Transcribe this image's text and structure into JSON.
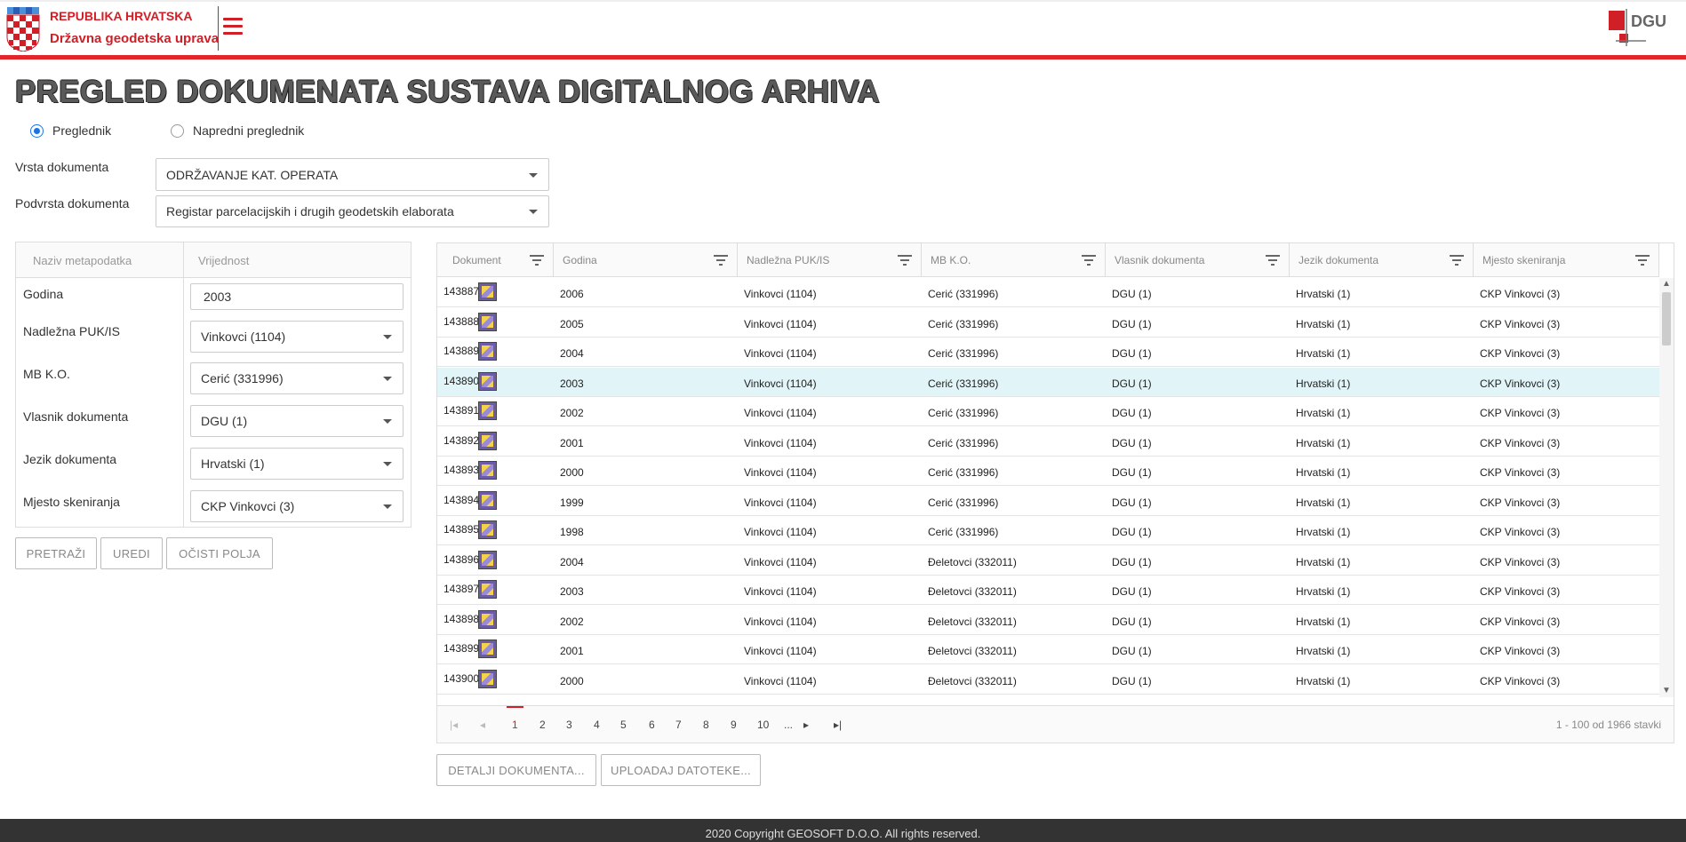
{
  "header": {
    "brand_line1": "REPUBLIKA HRVATSKA",
    "brand_line2": "Državna geodetska uprava",
    "logo_text": "DGU",
    "accent_color": "#e2262a"
  },
  "page_title": "PREGLED DOKUMENATA SUSTAVA DIGITALNOG ARHIVA",
  "mode": {
    "option1": "Preglednik",
    "option2": "Napredni preglednik",
    "selected": "Preglednik"
  },
  "filters": {
    "vrsta_label": "Vrsta dokumenta",
    "vrsta_value": "ODRŽAVANJE KAT. OPERATA",
    "podvrsta_label": "Podvrsta dokumenta",
    "podvrsta_value": "Registar parcelacijskih i drugih geodetskih elaborata"
  },
  "meta": {
    "col1": "Naziv metapodatka",
    "col2": "Vrijednost",
    "rows": [
      {
        "label": "Godina",
        "value": "2003"
      },
      {
        "label": "Nadležna PUK/IS",
        "value": "Vinkovci (1104)"
      },
      {
        "label": "MB K.O.",
        "value": "Cerić (331996)"
      },
      {
        "label": "Vlasnik dokumenta",
        "value": "DGU (1)"
      },
      {
        "label": "Jezik dokumenta",
        "value": "Hrvatski (1)"
      },
      {
        "label": "Mjesto skeniranja",
        "value": "CKP Vinkovci (3)"
      }
    ]
  },
  "buttons": {
    "search": "PRETRAŽI",
    "edit": "UREDI",
    "clear": "OČISTI POLJA",
    "details": "DETALJI DOKUMENTA...",
    "upload": "UPLOADAJ DATOTEKE..."
  },
  "grid": {
    "columns": [
      "Dokument",
      "Godina",
      "Nadležna PUK/IS",
      "MB K.O.",
      "Vlasnik dokumenta",
      "Jezik dokumenta",
      "Mjesto skeniranja"
    ],
    "rows": [
      [
        "143887",
        "2006",
        "Vinkovci (1104)",
        "Cerić (331996)",
        "DGU (1)",
        "Hrvatski (1)",
        "CKP Vinkovci (3)"
      ],
      [
        "143888",
        "2005",
        "Vinkovci (1104)",
        "Cerić (331996)",
        "DGU (1)",
        "Hrvatski (1)",
        "CKP Vinkovci (3)"
      ],
      [
        "143889",
        "2004",
        "Vinkovci (1104)",
        "Cerić (331996)",
        "DGU (1)",
        "Hrvatski (1)",
        "CKP Vinkovci (3)"
      ],
      [
        "143890",
        "2003",
        "Vinkovci (1104)",
        "Cerić (331996)",
        "DGU (1)",
        "Hrvatski (1)",
        "CKP Vinkovci (3)"
      ],
      [
        "143891",
        "2002",
        "Vinkovci (1104)",
        "Cerić (331996)",
        "DGU (1)",
        "Hrvatski (1)",
        "CKP Vinkovci (3)"
      ],
      [
        "143892",
        "2001",
        "Vinkovci (1104)",
        "Cerić (331996)",
        "DGU (1)",
        "Hrvatski (1)",
        "CKP Vinkovci (3)"
      ],
      [
        "143893",
        "2000",
        "Vinkovci (1104)",
        "Cerić (331996)",
        "DGU (1)",
        "Hrvatski (1)",
        "CKP Vinkovci (3)"
      ],
      [
        "143894",
        "1999",
        "Vinkovci (1104)",
        "Cerić (331996)",
        "DGU (1)",
        "Hrvatski (1)",
        "CKP Vinkovci (3)"
      ],
      [
        "143895",
        "1998",
        "Vinkovci (1104)",
        "Cerić (331996)",
        "DGU (1)",
        "Hrvatski (1)",
        "CKP Vinkovci (3)"
      ],
      [
        "143896",
        "2004",
        "Vinkovci (1104)",
        "Đeletovci (332011)",
        "DGU (1)",
        "Hrvatski (1)",
        "CKP Vinkovci (3)"
      ],
      [
        "143897",
        "2003",
        "Vinkovci (1104)",
        "Đeletovci (332011)",
        "DGU (1)",
        "Hrvatski (1)",
        "CKP Vinkovci (3)"
      ],
      [
        "143898",
        "2002",
        "Vinkovci (1104)",
        "Đeletovci (332011)",
        "DGU (1)",
        "Hrvatski (1)",
        "CKP Vinkovci (3)"
      ],
      [
        "143899",
        "2001",
        "Vinkovci (1104)",
        "Đeletovci (332011)",
        "DGU (1)",
        "Hrvatski (1)",
        "CKP Vinkovci (3)"
      ],
      [
        "143900",
        "2000",
        "Vinkovci (1104)",
        "Đeletovci (332011)",
        "DGU (1)",
        "Hrvatski (1)",
        "CKP Vinkovci (3)"
      ]
    ],
    "selected_row": "143890",
    "pages": [
      "1",
      "2",
      "3",
      "4",
      "5",
      "6",
      "7",
      "8",
      "9",
      "10",
      "..."
    ],
    "current_page": "1",
    "page_info": "1 - 100 od 1966 stavki"
  },
  "footer": "2020 Copyright GEOSOFT D.O.O. All rights reserved."
}
